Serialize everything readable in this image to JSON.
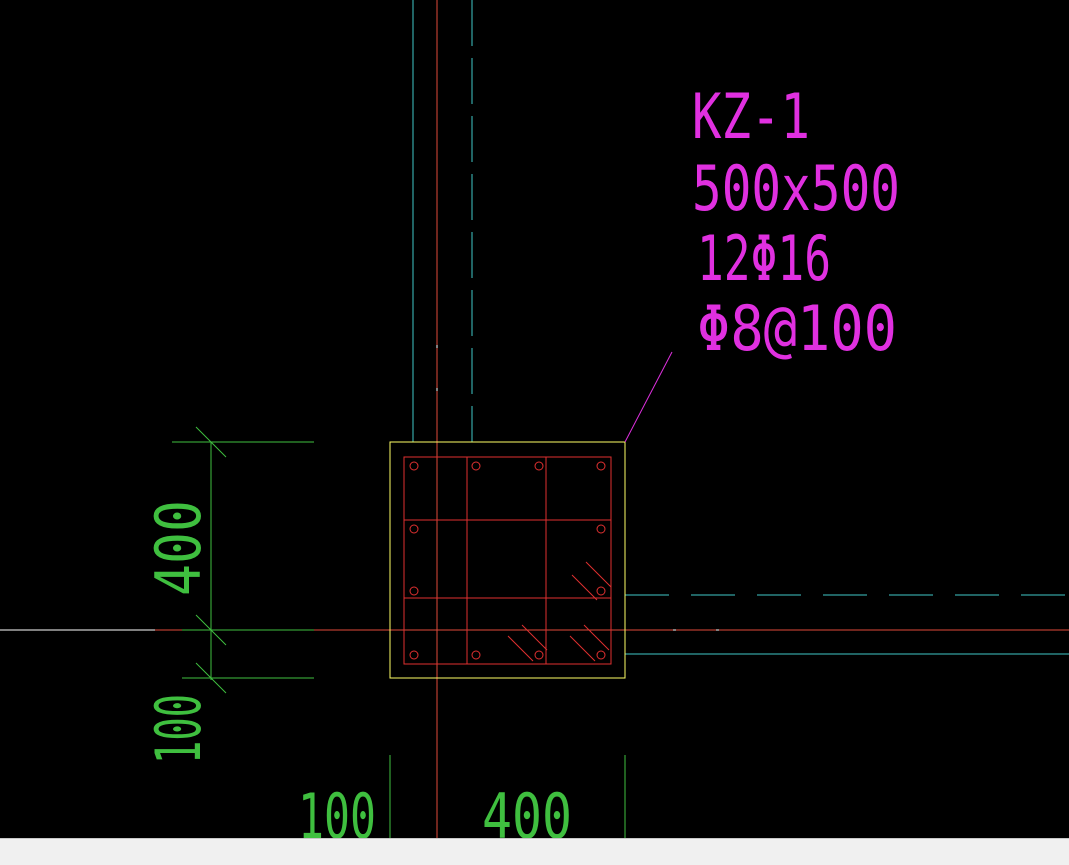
{
  "colors": {
    "background": "#000000",
    "axis_cyan": "#3fc8c8",
    "axis_red": "#e04a3a",
    "column_outline": "#ffff66",
    "rebar": "#e03030",
    "annotation": "#e030e0",
    "dimension": "#3fbf3f",
    "white_line": "#ffffff",
    "status_bar": "#f0f0f0"
  },
  "column_label": {
    "name": "KZ-1",
    "size": "500x500",
    "main_rebar": "12Φ16",
    "stirrup": "Φ8@100"
  },
  "dimensions": {
    "vertical_upper": "400",
    "vertical_lower": "100",
    "horizontal_left": "100",
    "horizontal_right": "400"
  }
}
